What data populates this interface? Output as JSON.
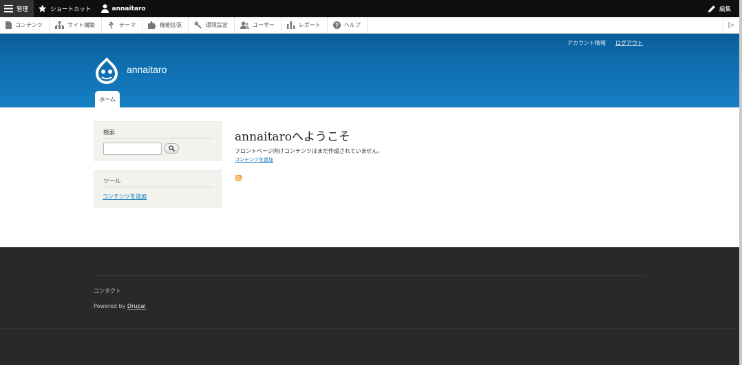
{
  "toolbar": {
    "manage_label": "管理",
    "shortcuts_label": "ショートカット",
    "user_label": "annaitaro",
    "edit_label": "編集"
  },
  "tray": {
    "items": [
      {
        "label": "コンテンツ",
        "icon": "document-icon"
      },
      {
        "label": "サイト構築",
        "icon": "sitemap-icon"
      },
      {
        "label": "テーマ",
        "icon": "brush-icon"
      },
      {
        "label": "機能拡張",
        "icon": "puzzle-icon"
      },
      {
        "label": "環境設定",
        "icon": "wrench-icon"
      },
      {
        "label": "ユーザー",
        "icon": "people-icon"
      },
      {
        "label": "レポート",
        "icon": "bar-chart-icon"
      },
      {
        "label": "ヘルプ",
        "icon": "help-icon"
      }
    ]
  },
  "header": {
    "account_label": "アカウント情報",
    "logout_label": "ログアウト",
    "site_name": "annaitaro",
    "home_tab": "ホーム"
  },
  "sidebar": {
    "search_title": "検索",
    "search_value": "",
    "tools_title": "ツール",
    "tools_link": "コンテンツを追加"
  },
  "main": {
    "title": "annaitaroへようこそ",
    "message": "フロントページ向けコンテンツはまだ作成されていません。",
    "add_link": "コンテンツを追加",
    "feed_icon": "rss-feed-icon"
  },
  "footer": {
    "contact_label": "コンタクト",
    "powered_prefix": "Powered by",
    "drupal_label": "Drupal"
  },
  "colors": {
    "header_blue": "#0f6fb0",
    "toolbar_black": "#0f0f0f",
    "footer_dark": "#292929",
    "link_blue": "#0071b8",
    "feed_orange": "#f39a1f"
  }
}
